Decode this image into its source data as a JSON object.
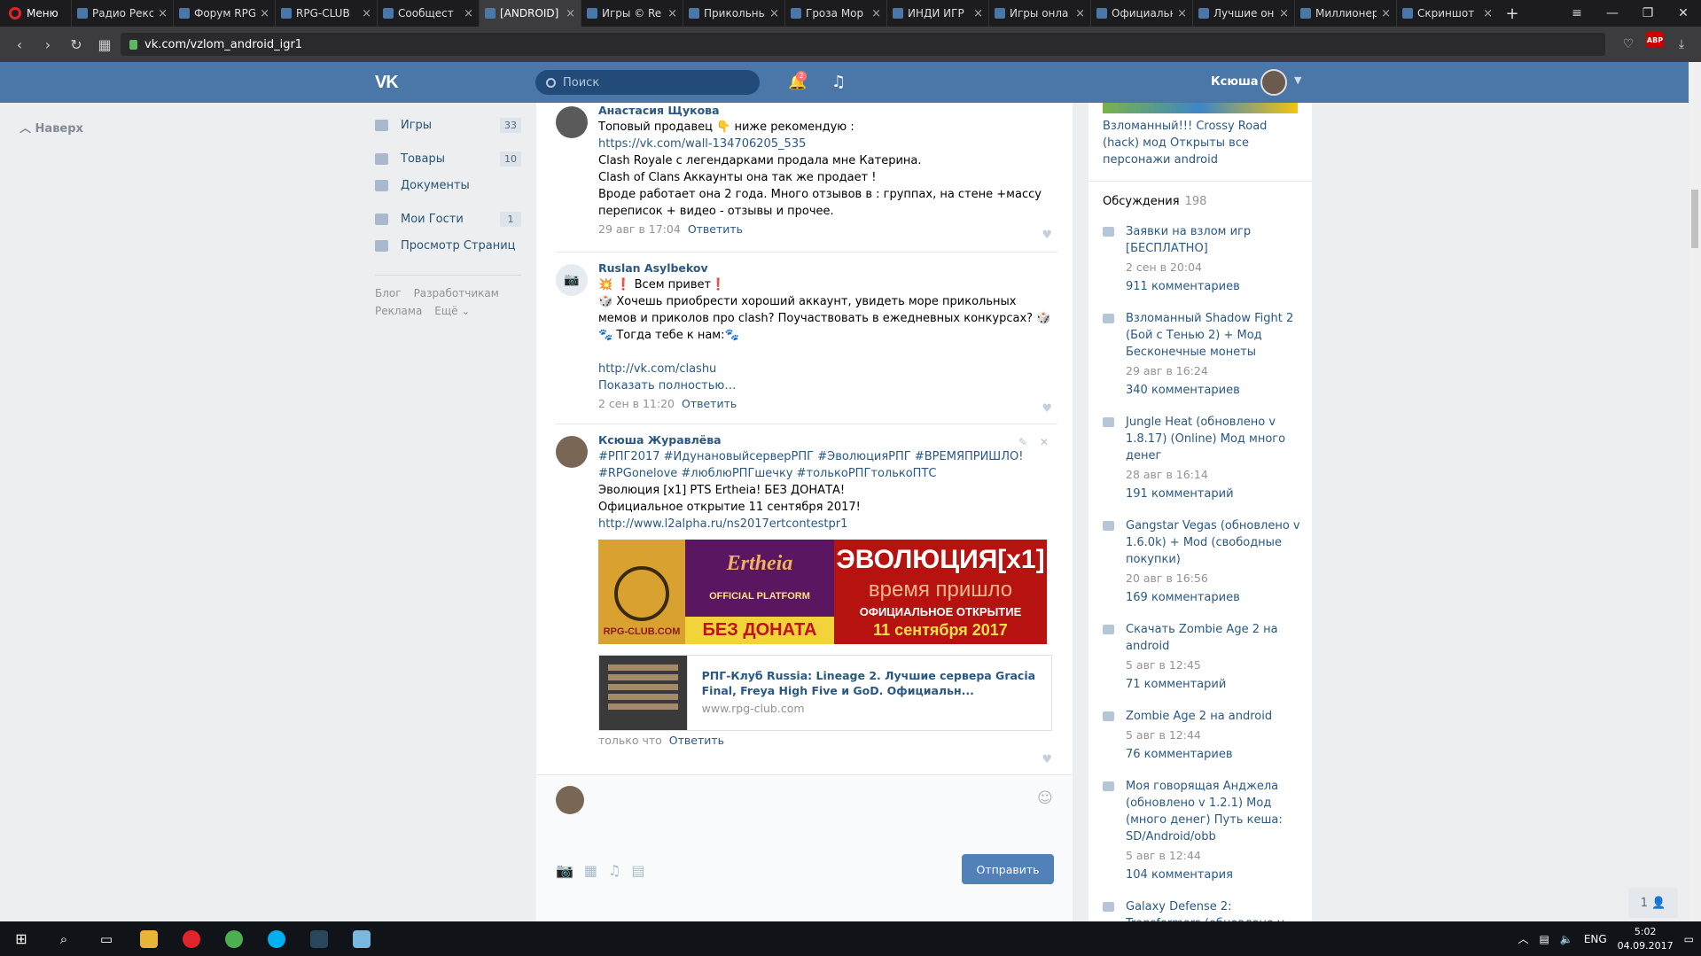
{
  "browser": {
    "menu_label": "Меню",
    "tabs": [
      {
        "label": "Радио Рекс"
      },
      {
        "label": "Форум RPG"
      },
      {
        "label": "RPG-CLUB"
      },
      {
        "label": "Сообщест"
      },
      {
        "label": "[ANDROID]"
      },
      {
        "label": "Игры © Re"
      },
      {
        "label": "Прикольны"
      },
      {
        "label": "Гроза Мор"
      },
      {
        "label": "ИНДИ ИГР"
      },
      {
        "label": "Игры онла"
      },
      {
        "label": "Официальн"
      },
      {
        "label": "Лучшие он"
      },
      {
        "label": "Миллионер"
      },
      {
        "label": "Скриншот"
      }
    ],
    "active_tab_index": 4,
    "url": "vk.com/vzlom_android_igr1",
    "abp_badge": "ABP"
  },
  "header": {
    "logo": "VK",
    "search_placeholder": "Поиск",
    "notifications_count": "2",
    "user_name": "Ксюша"
  },
  "left": {
    "to_top": "Наверх",
    "nav": [
      {
        "label": "Игры",
        "count": "33"
      },
      {
        "label": "Товары",
        "count": "10"
      },
      {
        "label": "Документы",
        "count": ""
      },
      {
        "label": "Мои Гости",
        "count": "1"
      },
      {
        "label": "Просмотр Страниц",
        "count": ""
      }
    ],
    "footer": {
      "blog": "Блог",
      "dev": "Разработчикам",
      "ads": "Реклама",
      "more": "Ещё ⌄"
    }
  },
  "comments": [
    {
      "author": "Анастасия Щукова",
      "line1": "Топовый продавец 👇 ниже рекомендую :",
      "link": "https://vk.com/wall-134706205_535",
      "line2": "Clash Royale с легендарками продала мне Катерина.",
      "line3": "Clash of Clans Аккаунты она так же продает !",
      "line4": "Вроде работает она 2 года. Много отзывов в : группах, на стене +массу переписок + видео - отзывы и прочее.",
      "date": "29 авг в 17:04",
      "reply": "Ответить"
    },
    {
      "author": "Ruslan Asylbekov",
      "line1": "💥 ❗ Всем привет❗",
      "line2": "🎲 Хочешь приобрести хороший аккаунт, увидеть море прикольных мемов и приколов про clash? Поучаствовать в ежедневных конкурсах? 🎲",
      "line3": "🐾 Тогда тебе к нам:🐾",
      "link": "http://vk.com/clashu",
      "show_more": "Показать полностью…",
      "date": "2 сен в 11:20",
      "reply": "Ответить"
    },
    {
      "author": "Ксюша Журавлёва",
      "tags1": "#РПГ2017 #ИдунановыйсерверРПГ #ЭволюцияРПГ #ВРЕМЯПРИШЛО!",
      "tags2": "#RPGonelove #люблюРПГшечку #толькоРПГтолькоПТС",
      "line1": "Эволюция [x1] PTS Ertheia! БЕЗ ДОНАТА!",
      "line2": "Официальное открытие 11 сентября 2017!",
      "link": "http://www.l2alpha.ru/ns2017ertcontestpr1",
      "banner": {
        "rpg": "RPG-CLUB.COM",
        "ertheia": "Ertheia",
        "official": "OFFICIAL PLATFORM",
        "no_donate": "БЕЗ ДОНАТА",
        "evolution": "ЭВОЛЮЦИЯ[x1]",
        "time": "время пришло",
        "opening": "ОФИЦИАЛЬНОЕ ОТКРЫТИЕ",
        "date": "11 сентября 2017"
      },
      "card_title": "РПГ-Клуб Russia: Lineage 2. Лучшие сервера Gracia Final, Freya High Five и GoD. Официальн...",
      "card_domain": "www.rpg-club.com",
      "date": "только что",
      "reply": "Ответить"
    }
  ],
  "composer": {
    "send": "Отправить"
  },
  "right": {
    "game_title": "Взломанный!!! Crossy Road (hack) мод Открыты все персонажи android",
    "discussions_label": "Обсуждения",
    "discussions_count": "198",
    "discussions": [
      {
        "title": "Заявки на взлом игр [БЕСПЛАТНО]",
        "date": "2 сен в 20:04",
        "count": "911 комментариев"
      },
      {
        "title": "Взломанный Shadow Fight 2 (Бой с Тенью 2) + Мод Бесконечные монеты",
        "date": "29 авг в 16:24",
        "count": "340 комментариев"
      },
      {
        "title": "Jungle Heat (обновлено v 1.8.17) (Online) Мод много денег",
        "date": "28 авг в 16:14",
        "count": "191 комментарий"
      },
      {
        "title": "Gangstar Vegas (обновлено v 1.6.0k) + Mod (свободные покупки)",
        "date": "20 авг в 16:56",
        "count": "169 комментариев"
      },
      {
        "title": "Скачать Zombie Age 2 на android",
        "date": "5 авг в 12:45",
        "count": "71 комментарий"
      },
      {
        "title": "Zombie Age 2 на android",
        "date": "5 авг в 12:44",
        "count": "76 комментариев"
      },
      {
        "title": "Моя говорящая Анджела (обновлено v 1.2.1) Мод (много денег) Путь кеша: SD/Android/obb",
        "date": "5 авг в 12:44",
        "count": "104 комментария"
      },
      {
        "title": "Galaxy Defense 2: Transformers (обновлено v",
        "date": "",
        "count": ""
      }
    ],
    "online_count": "1"
  },
  "taskbar": {
    "lang": "ENG",
    "time": "5:02",
    "date": "04.09.2017"
  }
}
